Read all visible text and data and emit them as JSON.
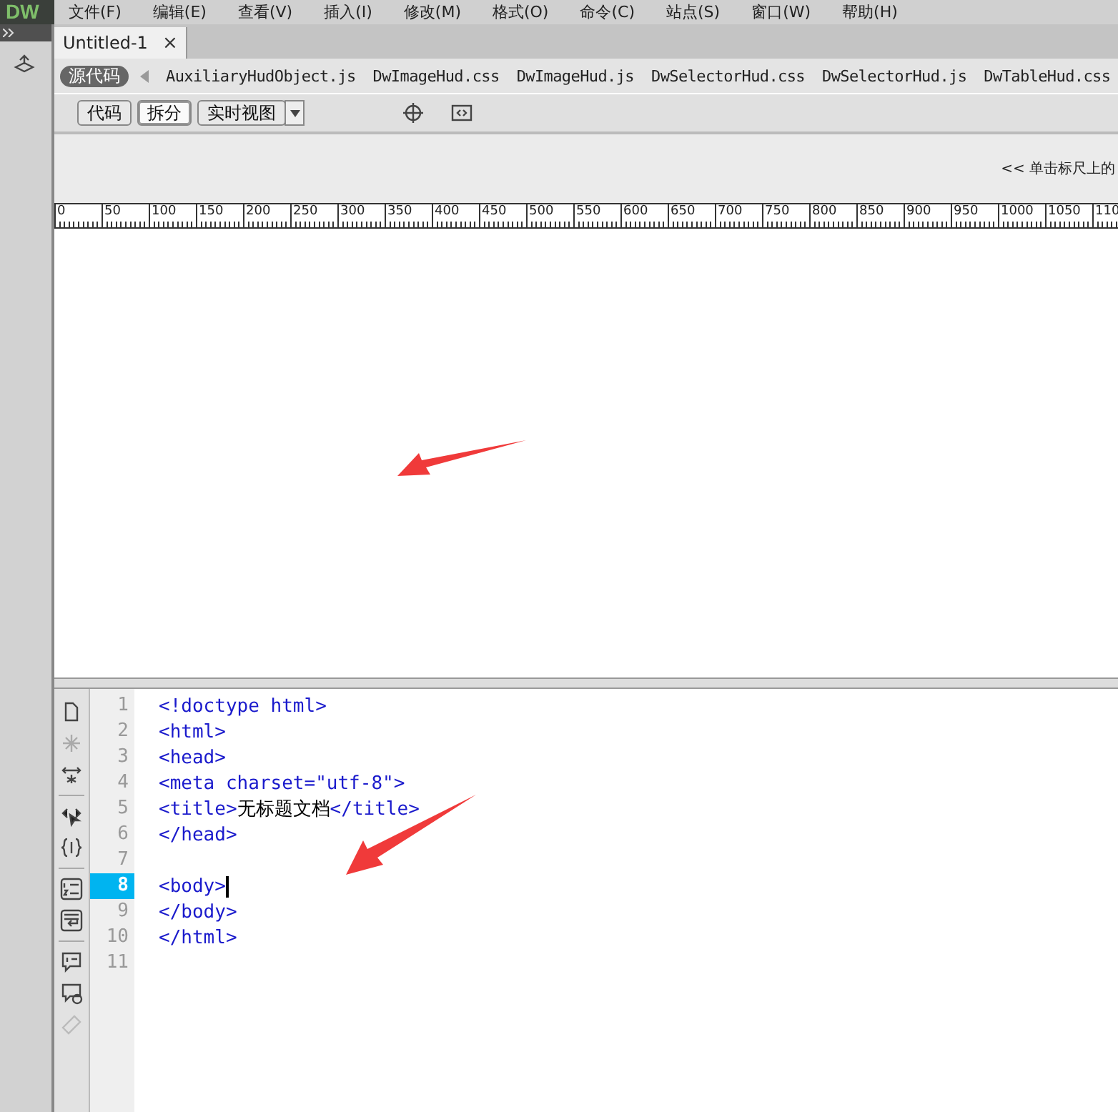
{
  "app": {
    "logo": "DW"
  },
  "menu": [
    "文件(F)",
    "编辑(E)",
    "查看(V)",
    "插入(I)",
    "修改(M)",
    "格式(O)",
    "命令(C)",
    "站点(S)",
    "窗口(W)",
    "帮助(H)"
  ],
  "document_tabs": [
    {
      "label": "Untitled-1",
      "selected": true,
      "close": "×"
    }
  ],
  "related_files": {
    "source_label": "源代码",
    "files": [
      "AuxiliaryHudObject.js",
      "DwImageHud.css",
      "DwImageHud.js",
      "DwSelectorHud.css",
      "DwSelectorHud.js",
      "DwTableHud.css"
    ]
  },
  "view_buttons": [
    {
      "label": "代码",
      "selected": false
    },
    {
      "label": "拆分",
      "selected": true
    },
    {
      "label": "实时视图",
      "selected": false
    }
  ],
  "design_view": {
    "hint": "<< 单击标尺上的"
  },
  "ruler": {
    "labels": [
      "0",
      "50",
      "100",
      "150",
      "200",
      "250",
      "300",
      "350",
      "400",
      "450",
      "500",
      "550",
      "600",
      "650",
      "700",
      "750",
      "800",
      "850",
      "900",
      "950",
      "1000",
      "1050",
      "110"
    ]
  },
  "code_lines": [
    {
      "number": "1",
      "selected": false,
      "parts": [
        {
          "kind": "tag",
          "text": "<!doctype html>"
        }
      ]
    },
    {
      "number": "2",
      "selected": false,
      "parts": [
        {
          "kind": "tag",
          "text": "<html>"
        }
      ]
    },
    {
      "number": "3",
      "selected": false,
      "parts": [
        {
          "kind": "tag",
          "text": "<head>"
        }
      ]
    },
    {
      "number": "4",
      "selected": false,
      "parts": [
        {
          "kind": "tag",
          "text": "<meta charset=\"utf-8\">"
        }
      ]
    },
    {
      "number": "5",
      "selected": false,
      "parts": [
        {
          "kind": "tag",
          "text": "<title>"
        },
        {
          "kind": "text",
          "text": "无标题文档"
        },
        {
          "kind": "tag",
          "text": "</title>"
        }
      ]
    },
    {
      "number": "6",
      "selected": false,
      "parts": [
        {
          "kind": "tag",
          "text": "</head>"
        }
      ]
    },
    {
      "number": "7",
      "selected": false
    },
    {
      "number": "8",
      "selected": true,
      "parts": [
        {
          "kind": "tag",
          "text": "<body>"
        }
      ]
    },
    {
      "number": "9",
      "selected": false,
      "parts": [
        {
          "kind": "tag",
          "text": "</body>"
        }
      ]
    },
    {
      "number": "10",
      "selected": false,
      "parts": [
        {
          "kind": "tag",
          "text": "</html>"
        }
      ]
    },
    {
      "number": "11",
      "selected": false
    }
  ]
}
